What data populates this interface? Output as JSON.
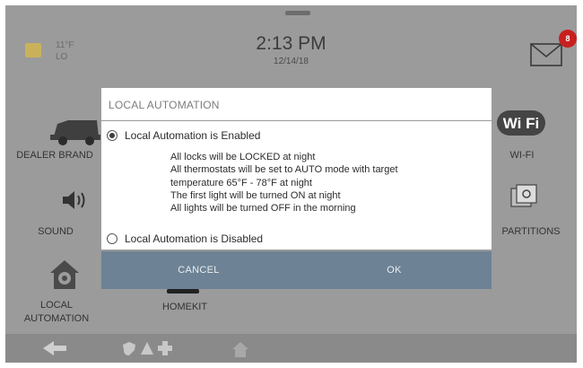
{
  "status": {
    "weather_line1": "11°F",
    "weather_line2": "LO"
  },
  "clock": {
    "time": "2:13 PM",
    "date": "12/14/18"
  },
  "mail": {
    "badge": "8"
  },
  "tiles": {
    "dealer_brand": "DEALER BRAND",
    "sound": "SOUND",
    "local_automation_line1": "LOCAL",
    "local_automation_line2": "AUTOMATION",
    "homekit": "HOMEKIT",
    "wifi": "WI-FI",
    "partitions": "PARTITIONS"
  },
  "dialog": {
    "title": "LOCAL AUTOMATION",
    "option_enabled": "Local Automation is Enabled",
    "option_disabled": "Local Automation is Disabled",
    "description": [
      "All locks will be LOCKED at night",
      "All thermostats will be set to AUTO mode with target",
      "temperature 65°F - 78°F at night",
      "The first light will be turned ON at night",
      "All lights will be turned OFF in the morning"
    ],
    "cancel_label": "CANCEL",
    "ok_label": "OK"
  }
}
